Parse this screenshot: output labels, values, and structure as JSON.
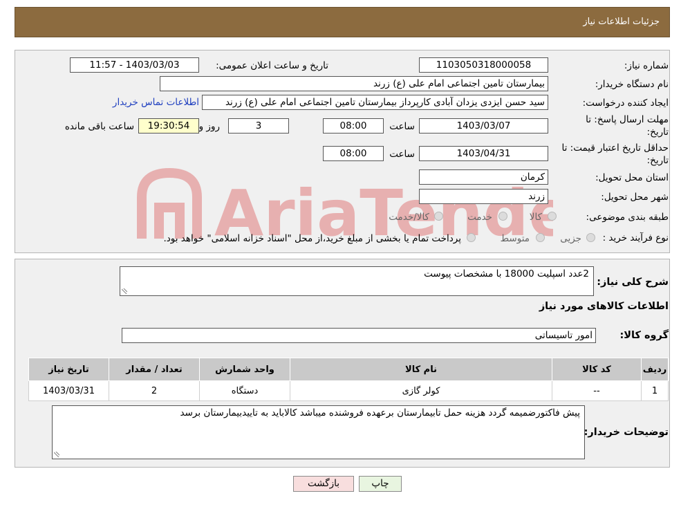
{
  "header": {
    "title": "جزئیات اطلاعات نیاز"
  },
  "form": {
    "need_number_label": "شماره نیاز:",
    "need_number": "1103050318000058",
    "announce_label": "تاریخ و ساعت اعلان عمومی:",
    "announce_value": "1403/03/03 - 11:57",
    "buyer_org_label": "نام دستگاه خریدار:",
    "buyer_org": "بیمارستان تامین اجتماعی امام علی (ع) زرند",
    "creator_label": "ایجاد کننده درخواست:",
    "creator": "سید حسن ایزدی یزدان آبادی کارپرداز بیمارستان تامین اجتماعی امام علی (ع) زرند",
    "contact_link": "اطلاعات تماس خریدار",
    "deadline_label_1": "مهلت ارسال پاسخ: تا",
    "deadline_label_2": "تاریخ:",
    "deadline_date": "1403/03/07",
    "time_label": "ساعت",
    "deadline_time": "08:00",
    "days_value": "3",
    "days_label": "روز و",
    "remaining_value": "19:30:54",
    "remaining_label": "ساعت باقی مانده",
    "validity_label_1": "حداقل تاریخ اعتبار قیمت: تا",
    "validity_label_2": "تاریخ:",
    "validity_date": "1403/04/31",
    "validity_time": "08:00",
    "province_label": "استان محل تحویل:",
    "province": "کرمان",
    "city_label": "شهر محل تحویل:",
    "city": "زرند",
    "category_label": "طبقه بندی موضوعی:",
    "category_options": [
      "کالا",
      "خدمت",
      "کالا/خدمت"
    ],
    "process_label": "نوع فرآیند خرید :",
    "process_options": [
      "جزیی",
      "متوسط"
    ],
    "process_note": "پرداخت تمام یا بخشی از مبلغ خرید،از محل \"اسناد خزانه اسلامی\" خواهد بود."
  },
  "details": {
    "summary_label": "شرح کلی نیاز:",
    "summary": "2عدد اسپلیت 18000 با مشخصات پیوست",
    "goods_info_title": "اطلاعات کالاهای مورد نیاز",
    "group_label": "گروه کالا:",
    "group": "امور تاسیساتی",
    "table": {
      "headers": [
        "ردیف",
        "کد کالا",
        "نام کالا",
        "واحد شمارش",
        "تعداد / مقدار",
        "تاریخ نیاز"
      ],
      "rows": [
        [
          "1",
          "--",
          "کولر گازی",
          "دستگاه",
          "2",
          "1403/03/31"
        ]
      ]
    },
    "buyer_notes_label": "توضیحات خریدار:",
    "buyer_notes": "پیش فاکتورضمیمه گردد هزینه حمل تابیمارستان برعهده فروشنده میباشد کالاباید به تاییدبیمارستان برسد"
  },
  "buttons": {
    "print": "چاپ",
    "back": "بازگشت"
  },
  "colors": {
    "header_bg": "#8c6b3f",
    "panel_bg": "#f0f0f0",
    "link": "#1f3fbf",
    "watermark": "#e07c7c"
  }
}
